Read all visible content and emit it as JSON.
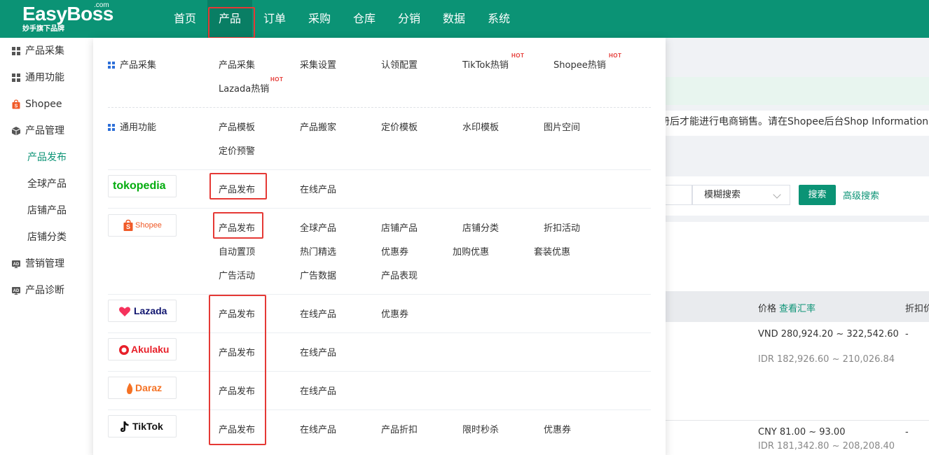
{
  "brand": {
    "name": "EasyBoss",
    "com": ".com",
    "tagline": "妙手旗下品牌"
  },
  "nav": [
    "首页",
    "产品",
    "订单",
    "采购",
    "仓库",
    "分销",
    "数据",
    "系统"
  ],
  "sidebar": {
    "items": [
      {
        "label": "产品采集",
        "icon": "grid-icon"
      },
      {
        "label": "通用功能",
        "icon": "grid-icon"
      },
      {
        "label": "Shopee",
        "icon": "shopee-bag-icon"
      },
      {
        "label": "产品管理",
        "icon": "box-icon"
      },
      {
        "label": "产品发布",
        "selected": true
      },
      {
        "label": "全球产品"
      },
      {
        "label": "店铺产品"
      },
      {
        "label": "店铺分类"
      },
      {
        "label": "营销管理",
        "icon": "ad-icon"
      },
      {
        "label": "产品诊断",
        "icon": "ad-icon"
      }
    ]
  },
  "dropdown": {
    "collect": {
      "label": "产品采集",
      "links": [
        "产品采集",
        "采集设置",
        "认领配置",
        "TikTok热销",
        "Shopee热销",
        "Lazada热销"
      ],
      "hot": "HOT"
    },
    "general": {
      "label": "通用功能",
      "links": [
        "产品模板",
        "产品搬家",
        "定价模板",
        "水印模板",
        "图片空间",
        "定价预警"
      ]
    },
    "tokopedia": {
      "logo": "tokopedia",
      "links": [
        "产品发布",
        "在线产品"
      ]
    },
    "shopee": {
      "logo": "Shopee",
      "links": [
        "产品发布",
        "全球产品",
        "店铺产品",
        "店铺分类",
        "折扣活动",
        "自动置顶",
        "热门精选",
        "优惠券",
        "加购优惠",
        "套装优惠",
        "广告活动",
        "广告数据",
        "产品表现"
      ]
    },
    "lazada": {
      "logo": "Lazada",
      "links": [
        "产品发布",
        "在线产品",
        "优惠券"
      ]
    },
    "akulaku": {
      "logo": "Akulaku",
      "links": [
        "产品发布",
        "在线产品"
      ]
    },
    "daraz": {
      "logo": "Daraz",
      "links": [
        "产品发布",
        "在线产品"
      ]
    },
    "tiktok": {
      "logo": "TikTok",
      "links": [
        "产品发布",
        "在线产品",
        "产品折扣",
        "限时秒杀",
        "优惠券"
      ]
    }
  },
  "background": {
    "warning": "册后才能进行电商销售。请在Shopee后台Shop Information > B",
    "search_mode": "模糊搜索",
    "search_button": "搜索",
    "advanced_search": "高级搜索",
    "col_price": "价格",
    "col_rate": "查看汇率",
    "col_discount": "折扣价",
    "row1": {
      "price_primary": "VND 280,924.20 ~ 322,542.60",
      "price_secondary": "IDR 182,926.60 ~ 210,026.84",
      "discount": "-"
    },
    "row2": {
      "price_primary": "CNY 81.00 ~ 93.00",
      "price_secondary": "IDR 181,342.80 ~ 208,208.40",
      "discount": "-"
    }
  },
  "colors": {
    "brand": "#0b9375",
    "highlight": "#e53935",
    "grid_icon": "#2d6fd8"
  }
}
